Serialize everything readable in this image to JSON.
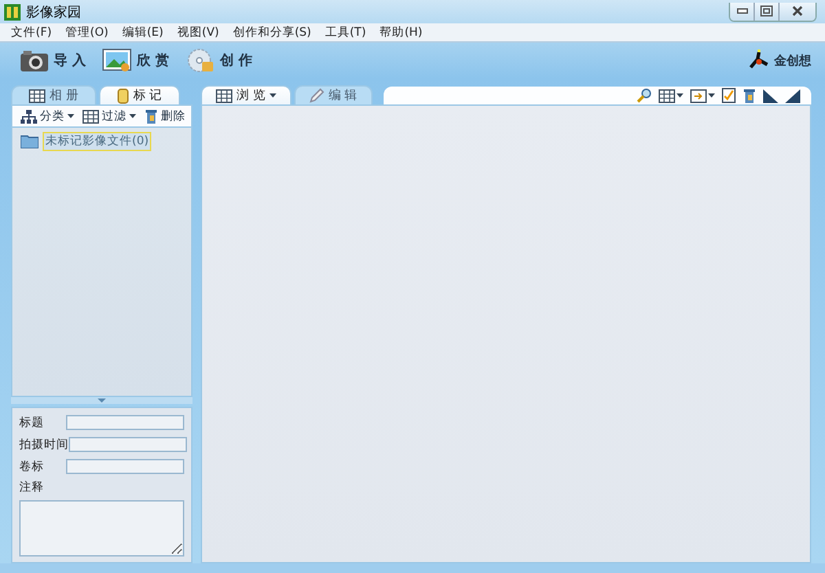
{
  "window": {
    "title": "影像家园"
  },
  "menu": [
    "文件(F)",
    "管理(O)",
    "编辑(E)",
    "视图(V)",
    "创作和分享(S)",
    "工具(T)",
    "帮助(H)"
  ],
  "toolbar": [
    {
      "kind": "camera",
      "label": "导 入"
    },
    {
      "kind": "photo",
      "label": "欣 赏"
    },
    {
      "kind": "disc",
      "label": "创 作"
    }
  ],
  "logo": "金创想",
  "left_tabs": [
    {
      "kind": "grid",
      "label": "相 册",
      "selected": false
    },
    {
      "kind": "tag",
      "label": "标 记",
      "selected": true
    }
  ],
  "left_actions": [
    {
      "kind": "tree",
      "label": "分类",
      "dropdown": true
    },
    {
      "kind": "grid",
      "label": "过滤",
      "dropdown": true
    },
    {
      "kind": "trash",
      "label": "删除",
      "dropdown": false
    }
  ],
  "tree": [
    {
      "label": "未标记影像文件(0)",
      "selected": true
    }
  ],
  "properties": {
    "fields": [
      {
        "label": "标题"
      },
      {
        "label": "拍摄时间"
      },
      {
        "label": "卷标"
      }
    ],
    "notes_label": "注释"
  },
  "right_tabs": [
    {
      "kind": "grid",
      "label": "浏 览",
      "selected": true,
      "dropdown": true
    },
    {
      "kind": "pencil",
      "label": "编 辑",
      "selected": false,
      "dropdown": false
    }
  ]
}
